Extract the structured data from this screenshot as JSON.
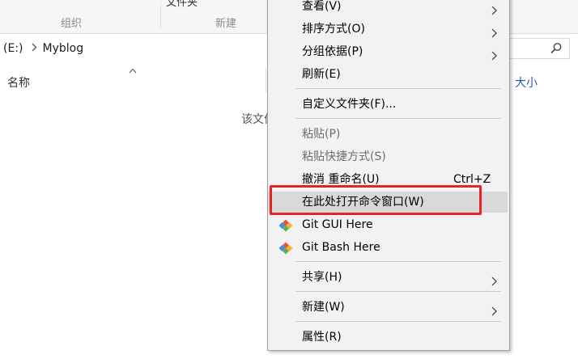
{
  "ribbon": {
    "group_organize": "组织",
    "group_new": "新建",
    "clipped_item": "文件夹"
  },
  "address": {
    "drive": "(E:)",
    "folder": "Myblog"
  },
  "columns": {
    "name": "名称",
    "size": "大小"
  },
  "empty_message": "该文件夹为空。",
  "context_menu": {
    "view": "查看(V)",
    "sort_by": "排序方式(O)",
    "group_by": "分组依据(P)",
    "refresh": "刷新(E)",
    "customize_folder": "自定义文件夹(F)...",
    "paste": "粘贴(P)",
    "paste_shortcut": "粘贴快捷方式(S)",
    "undo_rename": "撤消 重命名(U)",
    "undo_shortcut": "Ctrl+Z",
    "open_cmd_here": "在此处打开命令窗口(W)",
    "git_gui": "Git GUI Here",
    "git_bash": "Git Bash Here",
    "share": "共享(H)",
    "new": "新建(W)",
    "properties": "属性(R)"
  },
  "colors": {
    "highlight_border": "#e8202a",
    "menu_background": "#f2f2f2",
    "hover_background": "#d9d9d9",
    "disabled_text": "#6d6d6d",
    "column_link": "#1f5aa8"
  }
}
